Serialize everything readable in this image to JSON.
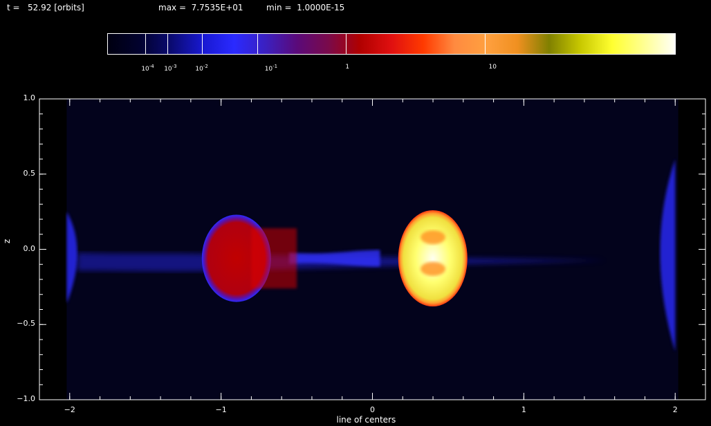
{
  "header": {
    "time_label": "t =",
    "time_value": "52.92",
    "time_unit": "[orbits]",
    "max_label": "max =",
    "max_value": "7.7535E+01",
    "min_label": "min =",
    "min_value": "1.0000E-15"
  },
  "colorbar": {
    "gradient_stops": [
      "#000010",
      "#02022e",
      "#0a0a70",
      "#1818d0",
      "#2a2aff",
      "#3b20c0",
      "#5a0a7a",
      "#7a0a4a",
      "#b00000",
      "#e01010",
      "#ff3a00",
      "#ff8a40",
      "#ffa040",
      "#f09020",
      "#808000",
      "#c8c800",
      "#ffff30",
      "#ffff90",
      "#fffff8"
    ],
    "labels": [
      {
        "base": "10",
        "exp": "-4",
        "pos": 0.06
      },
      {
        "base": "10",
        "exp": "-3",
        "pos": 0.1
      },
      {
        "base": "10",
        "exp": "-2",
        "pos": 0.155
      },
      {
        "base": "10",
        "exp": "-1",
        "pos": 0.277
      },
      {
        "base": "1",
        "exp": "",
        "pos": 0.419
      },
      {
        "base": "10",
        "exp": "",
        "pos": 0.671
      }
    ],
    "dividers": [
      0.066,
      0.105,
      0.166,
      0.264,
      0.419,
      0.665
    ]
  },
  "plot": {
    "xlabel": "line of centers",
    "ylabel": "z",
    "xlim": [
      -2.2,
      2.2
    ],
    "ylim": [
      -1.0,
      1.0
    ],
    "x_ticks": [
      {
        "value": -2,
        "label": "−2"
      },
      {
        "value": -1,
        "label": "−1"
      },
      {
        "value": 0,
        "label": "0"
      },
      {
        "value": 1,
        "label": "1"
      },
      {
        "value": 2,
        "label": "2"
      }
    ],
    "y_ticks": [
      {
        "value": 1.0,
        "label": "1.0"
      },
      {
        "value": 0.5,
        "label": "0.5"
      },
      {
        "value": 0.0,
        "label": "0.0"
      },
      {
        "value": -0.5,
        "label": "−0.5"
      },
      {
        "value": -1.0,
        "label": "−1.0"
      }
    ],
    "background_color": "#03031c",
    "stream_color": "#2020d0",
    "star_left": {
      "center_x": -0.99,
      "center_z": -0.06,
      "radius_x": 0.48,
      "radius_z": 0.29,
      "core": "#c00000",
      "rim": "#2a2aff"
    },
    "star_right": {
      "center_x": 0.49,
      "center_z": -0.06,
      "radius_x": 0.48,
      "radius_z": 0.32,
      "core": "#ffff70",
      "rim": "#ff3a10"
    }
  }
}
